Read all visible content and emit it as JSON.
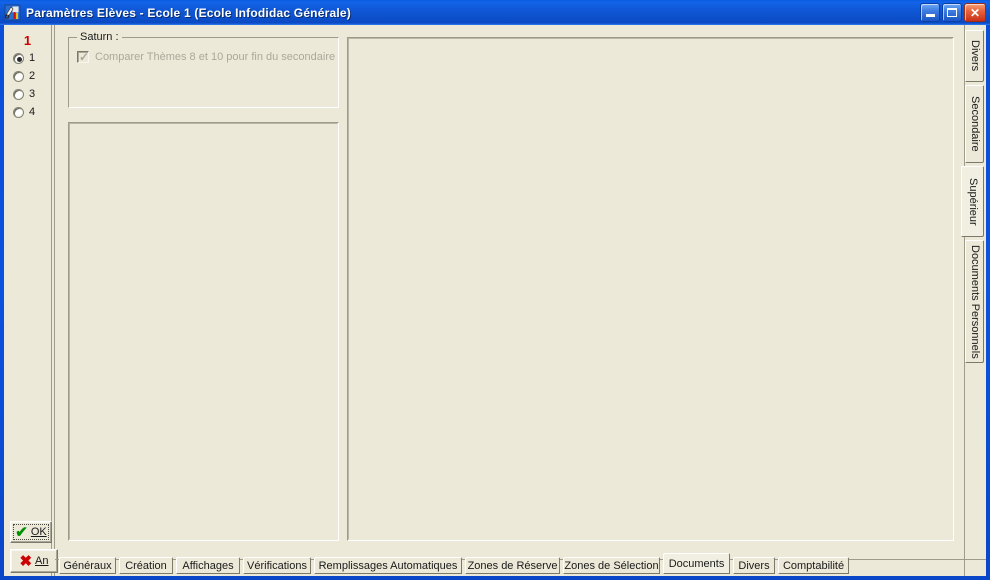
{
  "window": {
    "title": "Paramètres Elèves - Ecole 1 (Ecole Infodidac Générale)",
    "icon": "app-icon",
    "controls": {
      "minimize": "minimize-icon",
      "maximize": "maximize-icon",
      "close": "close-icon"
    },
    "titlebar_color": "#0b52e0",
    "client_color": "#ece9d8"
  },
  "sidebar": {
    "panel_number": "1",
    "panel_number_color": "#cc0000",
    "radios": [
      {
        "label": "1",
        "checked": true
      },
      {
        "label": "2",
        "checked": false
      },
      {
        "label": "3",
        "checked": false
      },
      {
        "label": "4",
        "checked": false
      }
    ],
    "ok_button": {
      "label": "OK",
      "icon": "green-check-icon"
    },
    "cancel_button": {
      "label": "An",
      "icon": "red-x-icon"
    }
  },
  "main": {
    "saturn_group": {
      "legend": "Saturn :",
      "checkbox": {
        "label": "Comparer Thèmes 8 et 10 pour fin du secondaire",
        "checked": true,
        "disabled": true
      }
    },
    "left_panel": {
      "content": ""
    },
    "right_panel": {
      "content": ""
    }
  },
  "bottom_tabs": {
    "active": "Documents",
    "items": [
      {
        "label": "Généraux"
      },
      {
        "label": "Création"
      },
      {
        "label": "Affichages"
      },
      {
        "label": "Vérifications"
      },
      {
        "label": "Remplissages Automatiques"
      },
      {
        "label": "Zones de Réserve"
      },
      {
        "label": "Zones de Sélection"
      },
      {
        "label": "Documents"
      },
      {
        "label": "Divers"
      },
      {
        "label": "Comptabilité"
      }
    ]
  },
  "right_tabs": {
    "active": "Supérieur",
    "items": [
      {
        "label": "Divers"
      },
      {
        "label": "Secondaire"
      },
      {
        "label": "Supérieur"
      },
      {
        "label": "Documents Personnels"
      }
    ]
  }
}
